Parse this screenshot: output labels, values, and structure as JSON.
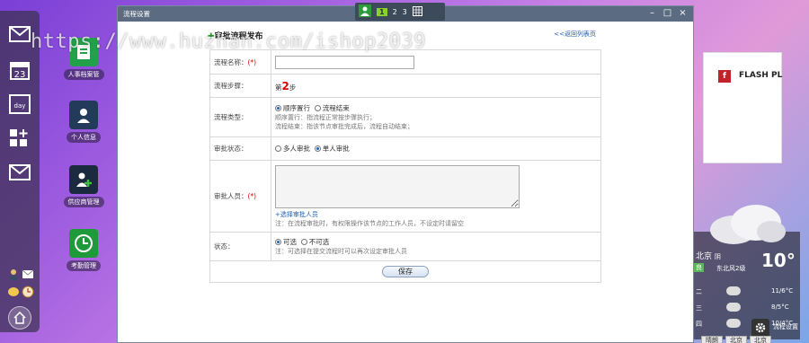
{
  "watermark": "https://www.huzhan.com/ishop2039",
  "window": {
    "title": "流程设置"
  },
  "pager": {
    "pages": [
      "1",
      "2",
      "3"
    ]
  },
  "desktop_apps": [
    {
      "label": "人事档案管"
    },
    {
      "label": "个人信息"
    },
    {
      "label": "供应商管理"
    },
    {
      "label": "考勤管理"
    }
  ],
  "form": {
    "title": "审批流程发布",
    "back_link": "<<返回列表页",
    "name_label": "流程名称：",
    "name_required": "(*)",
    "name_value": "",
    "step_label": "流程步骤：",
    "step_prefix": "第",
    "step_num": "2",
    "step_suffix": "步",
    "type_label": "流程类型：",
    "type_opt1": "顺序置行",
    "type_opt2": "流程结束",
    "type_hint1": "顺序置行：指流程正常按步骤执行；",
    "type_hint2": "流程结束：指该节点审批完成后，流程自动结束；",
    "status_label": "审批状态：",
    "status_opt1": "多人审批",
    "status_opt2": "单人审批",
    "approver_label": "审批人员：",
    "approver_required": "(*)",
    "approver_value": "",
    "select_link": "+选择审批人员",
    "approver_hint": "注：在流程审批时，有权限操作该节点的工作人员，不设定时请留空",
    "state_label": "状态：",
    "state_opt1": "可选",
    "state_opt2": "不可选",
    "state_hint": "注：可选择在提交流程时可以再次设定审批人员",
    "save_label": "保存"
  },
  "flash": {
    "logo": "f",
    "text": "FLASH PL"
  },
  "weather": {
    "city": "北京",
    "desc": "阴",
    "status": "良",
    "wind": "东北风2级",
    "temp": "10°",
    "days": [
      {
        "day": "二",
        "range": "11/6°C"
      },
      {
        "day": "三",
        "range": "8/5°C"
      },
      {
        "day": "四",
        "range": "10/4°C"
      }
    ]
  },
  "dock_badge": "23",
  "dock_day": "day",
  "settings_label": "流程设置",
  "bottom_tabs": [
    "晴朗",
    "北京",
    "北京"
  ]
}
